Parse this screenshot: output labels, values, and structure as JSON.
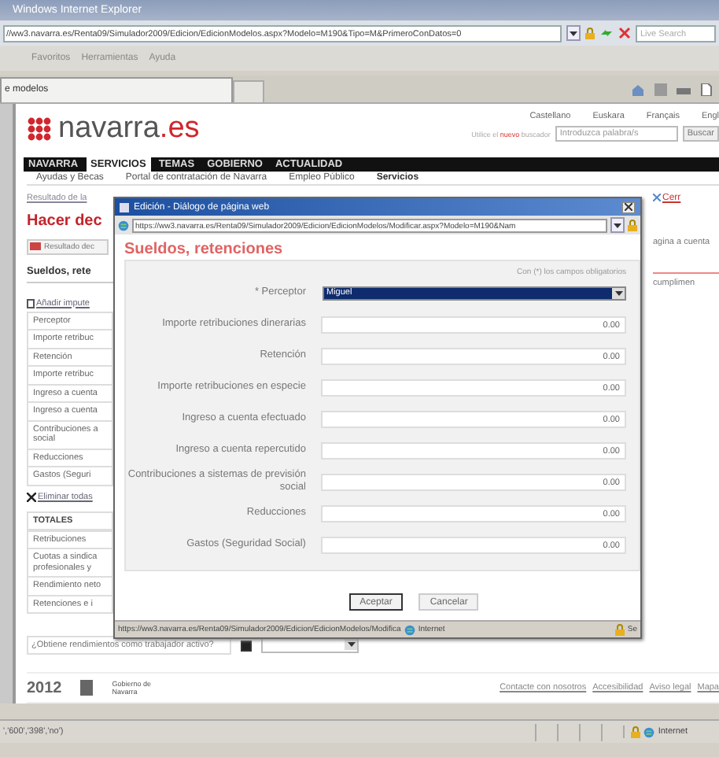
{
  "browser": {
    "title": "Windows Internet Explorer",
    "address": "//ww3.navarra.es/Renta09/Simulador2009/Edicion/EdicionModelos.aspx?Modelo=M190&Tipo=M&PrimeroConDatos=0",
    "search_placeholder": "Live Search",
    "menu": [
      "Favoritos",
      "Herramientas",
      "Ayuda"
    ],
    "tab": "e modelos",
    "status": "','600','398','no')",
    "zone": "Internet"
  },
  "site": {
    "logo": "navarra",
    "logo_suffix": ".es",
    "languages": [
      "Castellano",
      "Euskara",
      "Français",
      "Engl"
    ],
    "search_hint": "Utilice el **nuevo** buscador",
    "search_placeholder": "Introduzca palabra/s",
    "search_button": "Buscar",
    "nav": [
      {
        "label": "NAVARRA",
        "selected": false
      },
      {
        "label": "SERVICIOS",
        "selected": true
      },
      {
        "label": "TEMAS",
        "selected": false
      },
      {
        "label": "GOBIERNO",
        "selected": false
      },
      {
        "label": "ACTUALIDAD",
        "selected": false
      }
    ],
    "subnav": [
      "Ayudas y Becas",
      "Portal de contratación de Navarra",
      "Empleo Público",
      "Servicios"
    ]
  },
  "content": {
    "breadcrumb": "Resultado de la",
    "close_link": "Cerr",
    "heading": "Hacer dec",
    "result_button": "Resultado dec",
    "right_text_1": "agina a cuenta",
    "section": "Sueldos, rete",
    "right_text_2": "cumplimen",
    "add_link": "Añadir impute",
    "rows": [
      "Perceptor",
      "Importe retribuc",
      "Retención",
      "Importe retribuc",
      "Ingreso a cuenta",
      "Ingreso a cuenta",
      "Contribuciones a social",
      "Reducciones",
      "Gastos (Seguri"
    ],
    "delete_link": "Eliminar todas",
    "totals_heading": "TOTALES",
    "totals": [
      "Retribuciones",
      "Cuotas a sindica profesionales y",
      "Rendimiento neto",
      "Retenciones e i"
    ],
    "question": "¿Obtiene rendimientos como trabajador activo?",
    "question_checked": true
  },
  "footer": {
    "year": "2012",
    "gov": "Gobierno de Navarra",
    "links": [
      "Contacte con nosotros",
      "Accesibilidad",
      "Aviso legal",
      "Mapa"
    ]
  },
  "dialog": {
    "title": "Edición - Diálogo de página web",
    "url": "https://ww3.navarra.es/Renta09/Simulador2009/Edicion/EdicionModelos/Modificar.aspx?Modelo=M190&Nam",
    "heading": "Sueldos, retenciones",
    "required_note": "Con (*) los campos obligatorios",
    "fields": [
      {
        "label": "* Perceptor",
        "kind": "select",
        "value": "Miguel"
      },
      {
        "label": "Importe retribuciones dinerarias",
        "kind": "amount",
        "value": "0.00"
      },
      {
        "label": "Retención",
        "kind": "amount",
        "value": "0.00"
      },
      {
        "label": "Importe retribuciones en especie",
        "kind": "amount",
        "value": "0.00"
      },
      {
        "label": "Ingreso a cuenta efectuado",
        "kind": "amount",
        "value": "0.00"
      },
      {
        "label": "Ingreso a cuenta repercutido",
        "kind": "amount",
        "value": "0.00"
      },
      {
        "label": "Contribuciones a sistemas de previsión social",
        "kind": "amount",
        "value": "0.00"
      },
      {
        "label": "Reducciones",
        "kind": "amount",
        "value": "0.00"
      },
      {
        "label": "Gastos (Seguridad Social)",
        "kind": "amount",
        "value": "0.00"
      }
    ],
    "buttons": [
      "Aceptar",
      "Cancelar"
    ],
    "status_url": "https://ww3.navarra.es/Renta09/Simulador2009/Edicion/EdicionModelos/Modifica",
    "status_zone": "Internet",
    "status_security": "Se"
  }
}
